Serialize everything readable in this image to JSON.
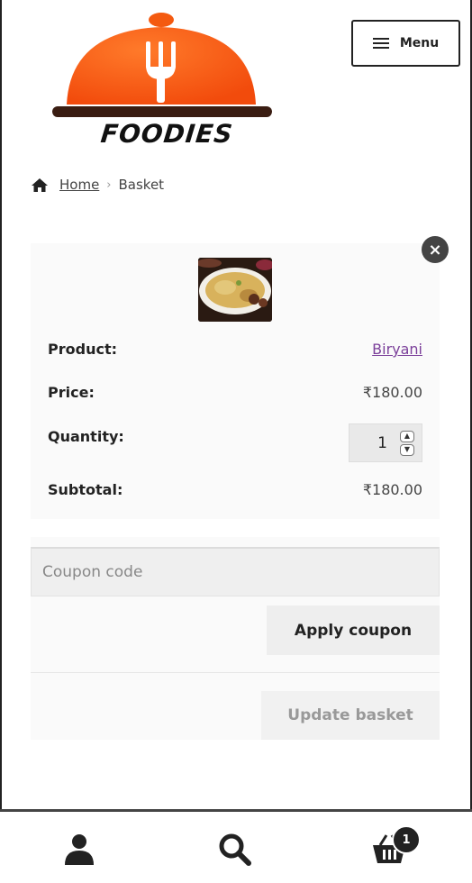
{
  "brand": {
    "name": "FOODIES"
  },
  "header": {
    "menu_label": "Menu"
  },
  "breadcrumb": {
    "home": "Home",
    "separator": "›",
    "current": "Basket"
  },
  "cart_item": {
    "product_label": "Product:",
    "product_value": "Biryani",
    "price_label": "Price:",
    "price_value": "₹180.00",
    "quantity_label": "Quantity:",
    "quantity_value": "1",
    "subtotal_label": "Subtotal:",
    "subtotal_value": "₹180.00"
  },
  "coupon": {
    "placeholder": "Coupon code",
    "apply_label": "Apply coupon"
  },
  "basket": {
    "update_label": "Update basket"
  },
  "footer": {
    "cart_count": "1"
  },
  "colors": {
    "accent": "#ff5a14",
    "text": "#222222",
    "link": "#7b3f9a"
  }
}
